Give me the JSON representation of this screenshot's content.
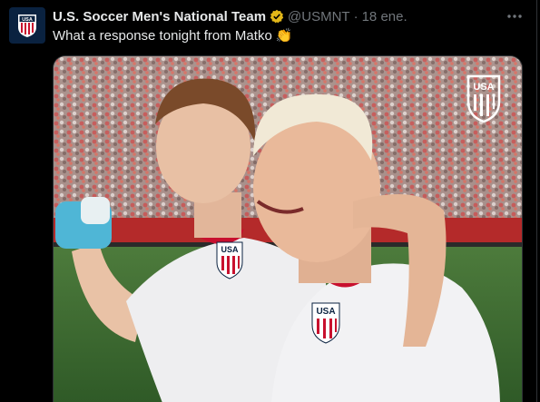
{
  "tweet": {
    "author_name": "U.S. Soccer Men's National Team",
    "handle": "@USMNT",
    "separator": "·",
    "date": "18 ene.",
    "text": "What a response tonight from Matko",
    "emoji": "👏"
  },
  "icons": {
    "avatar": "usa-crest-icon",
    "verified": "gold-verified-badge-icon",
    "more": "more-options-icon",
    "watermark": "usa-crest-watermark-icon"
  },
  "media": {
    "crest_text": "USA"
  },
  "colors": {
    "background": "#000000",
    "text_primary": "#e7e9ea",
    "text_secondary": "#71767b",
    "verified_gold": "#e2b719",
    "usa_navy": "#0a2240",
    "usa_red": "#c8102e"
  }
}
